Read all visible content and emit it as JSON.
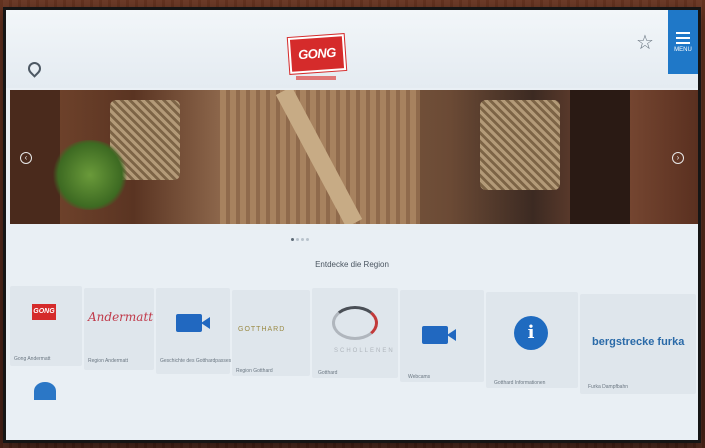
{
  "header": {
    "location_label": "",
    "logo_text": "GONG",
    "favorites_label": "",
    "menu_label": "MENU"
  },
  "carousel": {
    "prev_icon": "‹",
    "next_icon": "›",
    "dots": 4,
    "active_dot": 0
  },
  "section": {
    "title": "Entdecke die Region"
  },
  "tiles": [
    {
      "label": "Gong Andermatt",
      "logo": "GONG"
    },
    {
      "label": "Region Andermatt",
      "logo": "Andermatt"
    },
    {
      "label": "Geschichte des Gotthardpasses",
      "icon": "video-icon"
    },
    {
      "label": "Region Gotthard",
      "logo": "GOTTHARD"
    },
    {
      "label": "Gotthard",
      "logo": "SCHOLLENEN"
    },
    {
      "label": "Webcams",
      "icon": "video-icon"
    },
    {
      "label": "Gotthard Informationen",
      "icon": "info-icon"
    },
    {
      "label": "Furka Dampfbahn",
      "logo": "bergstrecke furka"
    }
  ],
  "colors": {
    "accent": "#1f78c8",
    "brand_red": "#d52b2b"
  }
}
